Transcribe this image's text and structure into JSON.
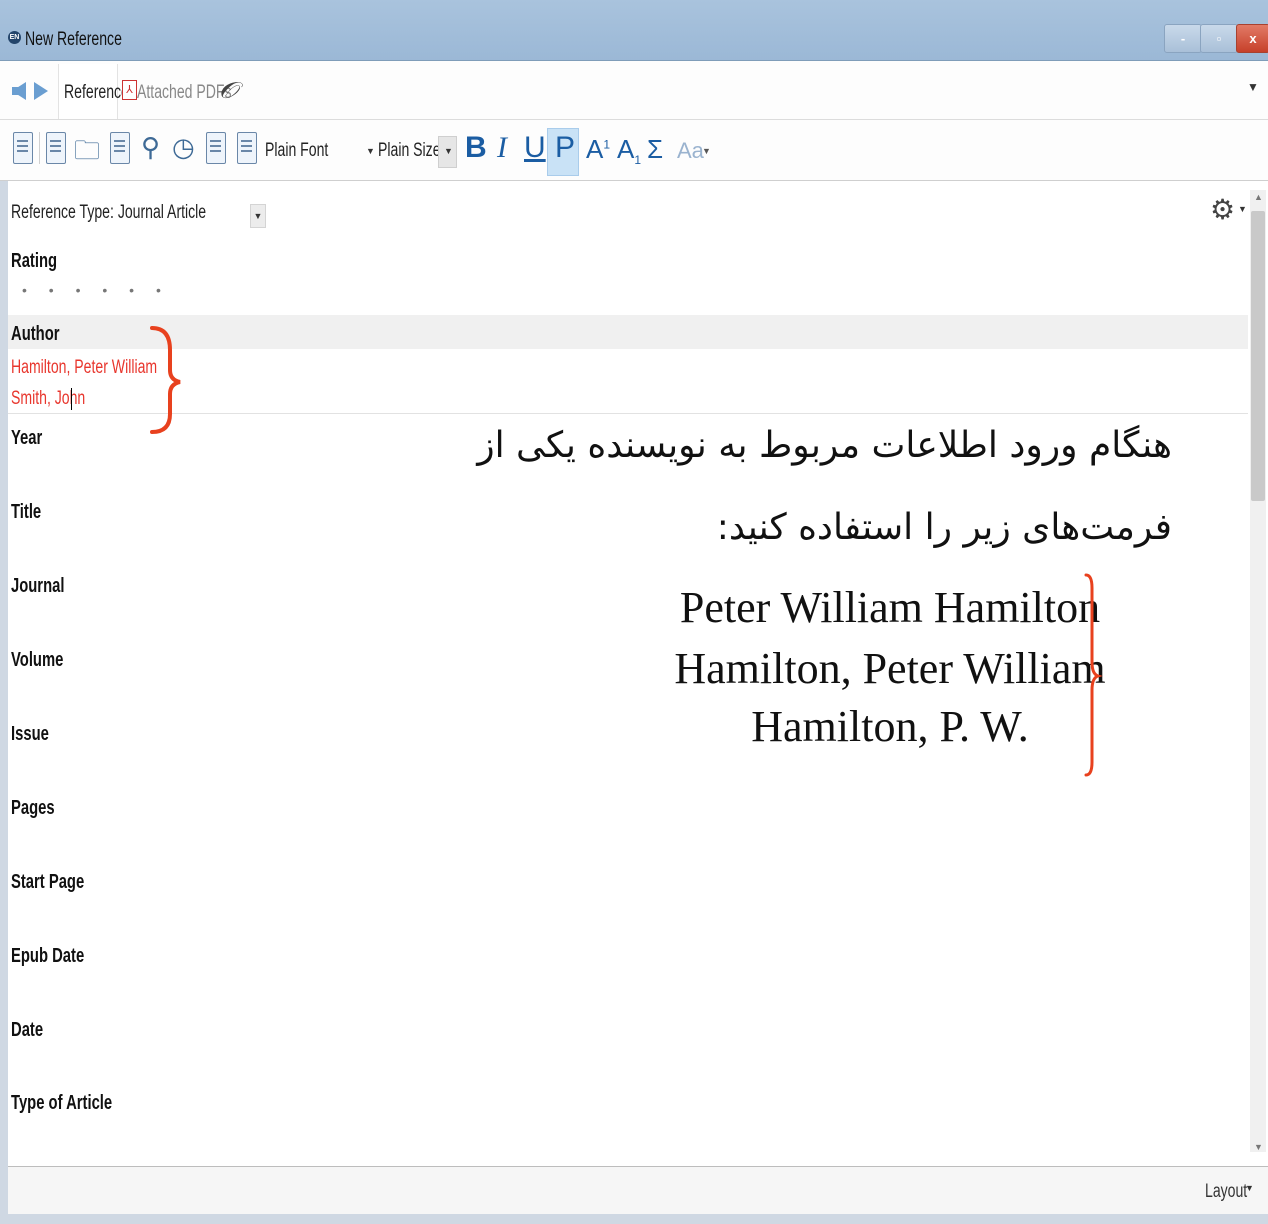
{
  "window": {
    "title": "New Reference",
    "app_icon": "endnote-icon",
    "controls": {
      "minimize": "-",
      "maximize": "▫",
      "close": "x"
    }
  },
  "tabs": {
    "reference": "Reference",
    "attached_pdfs": "Attached PDFs"
  },
  "toolbar": {
    "font": "Plain Font",
    "size": "Plain Size",
    "bold": "B",
    "italic": "I",
    "underline": "U",
    "plain": "P",
    "superscript_base": "A",
    "superscript": "1",
    "subscript_base": "A",
    "subscript": "1",
    "symbol": "Σ",
    "case": "Aa"
  },
  "form": {
    "reference_type": "Reference Type: Journal Article",
    "rating_label": "Rating",
    "rating_value": 0,
    "rating_dots": "• • • • • •",
    "fields": {
      "author": "Author",
      "year": "Year",
      "title": "Title",
      "journal": "Journal",
      "volume": "Volume",
      "issue": "Issue",
      "pages": "Pages",
      "start_page": "Start Page",
      "epub_date": "Epub Date",
      "date": "Date",
      "type_of_article": "Type of Article"
    },
    "authors": [
      "Hamilton, Peter William",
      "Smith, John"
    ]
  },
  "annotation": {
    "instruction_line1": "هنگام ورود اطلاعات مربوط به نویسنده یکی از",
    "instruction_line2": "فرمت‌های زیر را استفاده کنید:",
    "formats": [
      "Peter William Hamilton",
      "Hamilton, Peter William",
      "Hamilton, P. W."
    ],
    "brace_color": "#e8411e"
  },
  "footer": {
    "layout": "Layout"
  },
  "colors": {
    "titlebar": "#a9c3dd",
    "author_text": "#e8362d",
    "format_buttons": "#1b5da3",
    "plain_active": "#c9e2f6"
  }
}
